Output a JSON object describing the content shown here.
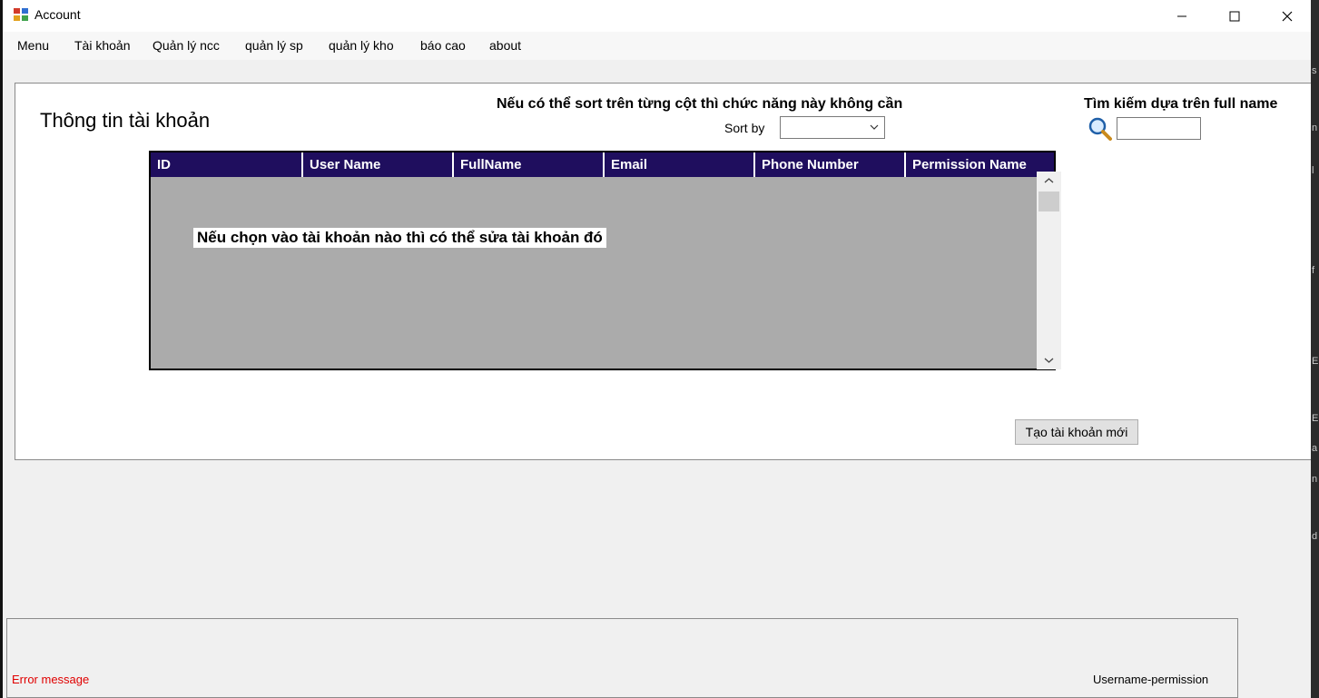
{
  "window": {
    "title": "Account",
    "minimize_glyph": "—",
    "maximize_glyph": "☐",
    "close_glyph": "✕"
  },
  "menu": [
    "Menu",
    "Tài khoản",
    "Quản lý ncc",
    "quản lý sp",
    "quản lý kho",
    "báo cao",
    "about"
  ],
  "panel": {
    "title": "Thông tin tài khoản",
    "sort_note": "Nếu có thể sort trên từng cột thì chức năng này không cần",
    "sort_label": "Sort by",
    "sort_value": "",
    "search_note": "Tìm kiếm dựa trên full name",
    "search_value": ""
  },
  "grid": {
    "columns": [
      "ID",
      "User Name",
      "FullName",
      "Email",
      "Phone Number",
      "Permission Name"
    ],
    "rows": [],
    "note": "Nếu chọn vào tài khoản nào thì có thể sửa tài khoản đó"
  },
  "actions": {
    "create_account": "Tạo tài khoản mới"
  },
  "status": {
    "error": "Error message",
    "user": "Username-permission"
  },
  "colors": {
    "grid_header": "#1f0e5e",
    "grid_body": "#ababab",
    "error_text": "#e00000"
  },
  "icons": {
    "search": "magnifier-icon",
    "dropdown": "chevron-down-icon"
  }
}
